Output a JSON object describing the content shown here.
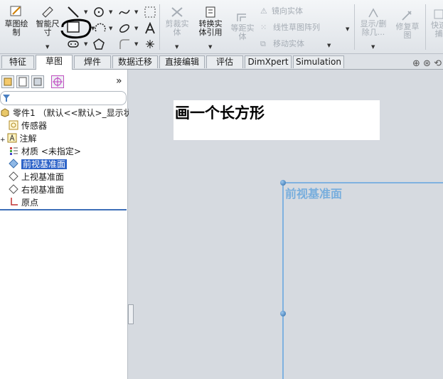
{
  "toolbar": {
    "sketch_label_1": "草图绘",
    "sketch_label_2": "制",
    "smart_dim_label_1": "智能尺",
    "smart_dim_label_2": "寸",
    "trim_label_1": "剪裁实",
    "trim_label_2": "体",
    "convert_label_1": "转换实",
    "convert_label_2": "体引用",
    "offset_label_1": "等距实",
    "offset_label_2": "体",
    "mirror_label": "镜向实体",
    "linear_pattern_label": "线性草图阵列",
    "move_label": "移动实体",
    "show_delete_label_1": "显示/删",
    "show_delete_label_2": "除几...",
    "repair_label_1": "修复草",
    "repair_label_2": "图",
    "quick_label_1": "快速",
    "quick_label_2": "捕"
  },
  "tabs": [
    {
      "label": "特征"
    },
    {
      "label": "草图"
    },
    {
      "label": "焊件"
    },
    {
      "label": "数据迁移"
    },
    {
      "label": "直接编辑"
    },
    {
      "label": "评估"
    },
    {
      "label": "DimXpert"
    },
    {
      "label": "Simulation"
    }
  ],
  "active_tab": "草图",
  "tree": {
    "part": "零件1 （默认<<默认>_显示状态",
    "sensors": "传感器",
    "annotations": "注解",
    "material": "材质 <未指定>",
    "front_plane": "前视基准面",
    "top_plane": "上视基准面",
    "right_plane": "右视基准面",
    "origin": "原点"
  },
  "panel": {
    "expand_glyph": "»"
  },
  "canvas": {
    "instruction": "画一个长方形",
    "plane_label": "前视基准面"
  },
  "colors": {
    "plane": "#7fb2e0",
    "selection": "#2d63c8",
    "highlight_circle": "#000000"
  }
}
